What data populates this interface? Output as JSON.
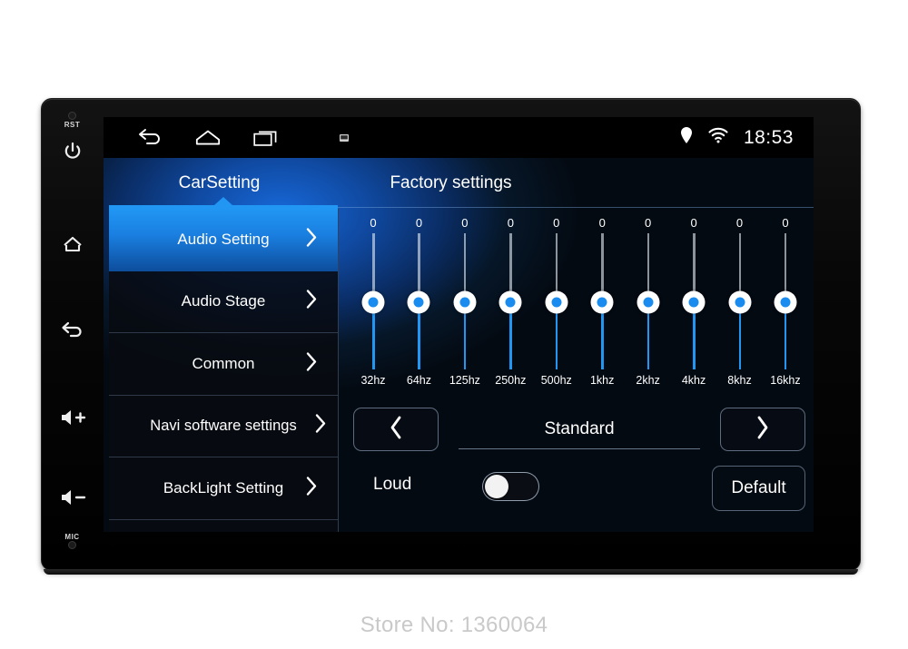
{
  "device": {
    "bezel_buttons": [
      {
        "name": "reset",
        "label": "RST"
      },
      {
        "name": "power",
        "label": ""
      },
      {
        "name": "home",
        "label": ""
      },
      {
        "name": "back",
        "label": ""
      },
      {
        "name": "volume-up",
        "label": ""
      },
      {
        "name": "volume-down",
        "label": ""
      },
      {
        "name": "microphone",
        "label": "MIC"
      }
    ]
  },
  "statusbar": {
    "nav": [
      {
        "icon": "back-icon"
      },
      {
        "icon": "home-icon"
      },
      {
        "icon": "recent-apps-icon"
      },
      {
        "icon": "screenshot-icon"
      }
    ],
    "location_icon": "location-pin-icon",
    "wifi_icon": "wifi-icon",
    "time": "18:53"
  },
  "tabs": [
    {
      "label": "CarSetting",
      "active": true
    },
    {
      "label": "Factory settings",
      "active": false
    }
  ],
  "sidebar": {
    "items": [
      {
        "label": "Audio Setting",
        "selected": true
      },
      {
        "label": "Audio Stage",
        "selected": false
      },
      {
        "label": "Common",
        "selected": false
      },
      {
        "label": "Navi software settings",
        "selected": false
      },
      {
        "label": "BackLight Setting",
        "selected": false
      }
    ],
    "chevron_icon": "chevron-right-icon"
  },
  "equalizer": {
    "bands": [
      {
        "freq": "32hz",
        "value": "0"
      },
      {
        "freq": "64hz",
        "value": "0"
      },
      {
        "freq": "125hz",
        "value": "0"
      },
      {
        "freq": "250hz",
        "value": "0"
      },
      {
        "freq": "500hz",
        "value": "0"
      },
      {
        "freq": "1khz",
        "value": "0"
      },
      {
        "freq": "2khz",
        "value": "0"
      },
      {
        "freq": "4khz",
        "value": "0"
      },
      {
        "freq": "8khz",
        "value": "0"
      },
      {
        "freq": "16khz",
        "value": "0"
      }
    ]
  },
  "controls": {
    "preset_prev_icon": "chevron-left-icon",
    "preset_next_icon": "chevron-right-icon",
    "preset_name": "Standard",
    "loud_label": "Loud",
    "loud_on": false,
    "default_label": "Default"
  },
  "footer": {
    "store_no": "Store No: 1360064"
  },
  "colors": {
    "accent": "#2196f3",
    "selected_start": "#2196f3",
    "selected_end": "#0d4d9c",
    "screen_bg": "#06090f",
    "bezel": "#0a0a0a",
    "text": "#ffffff",
    "footer_text": "#c9c9c9"
  }
}
